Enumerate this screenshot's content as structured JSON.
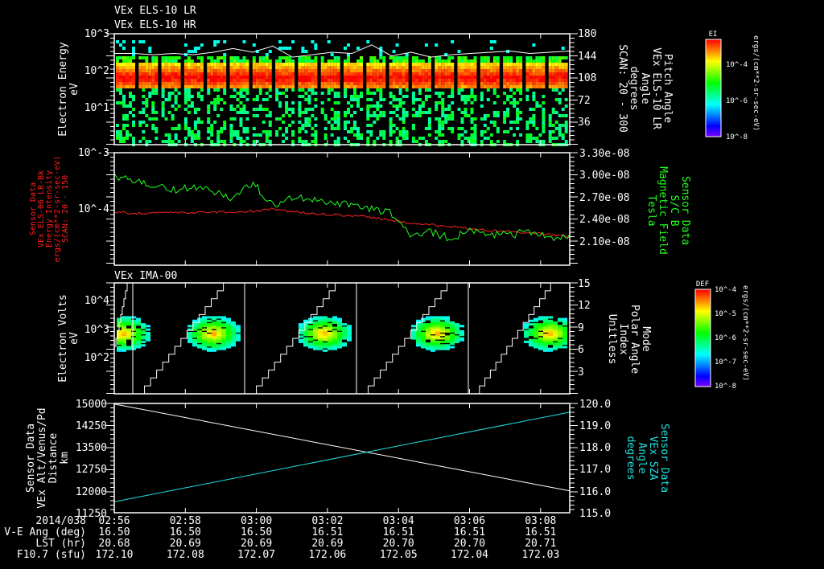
{
  "titles": {
    "p1a": "VEx ELS-10 LR",
    "p1b": "VEx ELS-10 HR",
    "p3": "VEx IMA-00"
  },
  "colors": {
    "green": "#20ff20",
    "red": "#ff2020",
    "cyan": "#20e0e0",
    "white": "#ffffff"
  },
  "chart_data": [
    {
      "type": "heatmap",
      "title": "VEx ELS-10 LR / VEx ELS-10 HR",
      "ylabel": [
        "Electron Energy",
        "eV"
      ],
      "yticks": [
        "10^3",
        "10^2",
        "10^1"
      ],
      "ylim_log10": [
        0,
        3
      ],
      "y2label": [
        "Pitch Angle",
        "VEx ELS-10 LR",
        "Angle",
        "degrees",
        "SCAN: 20 - 300"
      ],
      "y2ticks": [
        "180",
        "144",
        "108",
        "72",
        "36"
      ],
      "y2lim": [
        0,
        180
      ],
      "colorbar": {
        "label": "EI",
        "ticks": [
          "10^-4",
          "10^-6",
          "10^-8"
        ],
        "units": "ergs/(cm**2-sr-sec-eV)"
      },
      "peak_energy_eV": 60,
      "scan_blocks": 20,
      "pitch_angle_line_deg": [
        148,
        148,
        146,
        148,
        146,
        150,
        156,
        150,
        160,
        142,
        146,
        150,
        148,
        162,
        144,
        150,
        142,
        146,
        148,
        150,
        152,
        148,
        150,
        152
      ]
    },
    {
      "type": "line",
      "ylabel": [
        "Sensor Data",
        "VEx ELS-06 LR-Bk",
        "Energy Intensity",
        "ergs/(cm**2-sr-sec-eV)",
        "SCAN: 20 - 150"
      ],
      "yticks": [
        "10^-3",
        "10^-4"
      ],
      "ylim_log10": [
        -5,
        -3
      ],
      "y2label": [
        "Sensor Data",
        "S/C B",
        "Magnetic Field",
        "Tesla"
      ],
      "y2ticks": [
        "3.30e-08",
        "3.00e-08",
        "2.70e-08",
        "2.40e-08",
        "2.10e-08"
      ],
      "y2lim": [
        1.8e-08,
        3.3e-08
      ],
      "series": [
        {
          "name": "ELS-06 LR-Bk energy intensity",
          "color": "red",
          "axis": "left",
          "values_log10": [
            -4.05,
            -4.08,
            -4.07,
            -4.06,
            -4.07,
            -4.05,
            -4.06,
            -4.04,
            -4.0,
            -4.05,
            -4.08,
            -4.1,
            -4.12,
            -4.15,
            -4.2,
            -4.25,
            -4.28,
            -4.32,
            -4.35,
            -4.38,
            -4.4,
            -4.42,
            -4.45,
            -4.5
          ]
        },
        {
          "name": "S/C B magnetic field",
          "color": "green",
          "axis": "right",
          "values": [
            3e-08,
            2.92e-08,
            2.88e-08,
            2.8e-08,
            2.85e-08,
            2.78e-08,
            2.7e-08,
            2.9e-08,
            2.6e-08,
            2.7e-08,
            2.68e-08,
            2.65e-08,
            2.6e-08,
            2.55e-08,
            2.5e-08,
            2.2e-08,
            2.25e-08,
            2.15e-08,
            2.28e-08,
            2.22e-08,
            2.2e-08,
            2.25e-08,
            2.15e-08,
            2.2e-08
          ]
        }
      ]
    },
    {
      "type": "heatmap",
      "title": "VEx IMA-00",
      "ylabel": [
        "Electron Volts",
        "eV"
      ],
      "yticks": [
        "10^4",
        "10^3",
        "10^2"
      ],
      "ylim_log10": [
        0.8,
        4.6
      ],
      "y2label": [
        "Mode",
        "Polar Angle",
        "Index",
        "Unitless"
      ],
      "y2ticks": [
        "15",
        "12",
        "9",
        "6",
        "3"
      ],
      "y2lim": [
        0,
        15
      ],
      "colorbar": {
        "label": "DEF",
        "ticks": [
          "10^-4",
          "10^-5",
          "10^-6",
          "10^-7",
          "10^-8"
        ],
        "units": "ergs/(cm**2-sr-sec-eV)"
      },
      "blob_centers_time": [
        "02:56:15",
        "02:58:45",
        "03:01:50",
        "03:05:00",
        "03:08:10"
      ],
      "scan_resets_time": [
        "02:56:30",
        "02:59:40",
        "03:02:50",
        "03:05:58"
      ]
    },
    {
      "type": "line",
      "ylabel": [
        "Sensor Data",
        "VEx Alt/Venus/Pd",
        "Distance",
        "km"
      ],
      "yticks": [
        "15000",
        "14250",
        "13500",
        "12750",
        "12000",
        "11250"
      ],
      "ylim": [
        11250,
        15000
      ],
      "y2label": [
        "Sensor Data",
        "VEx SZA",
        "Angle",
        "degrees"
      ],
      "y2ticks": [
        "120.0",
        "119.0",
        "118.0",
        "117.0",
        "116.0",
        "115.0"
      ],
      "y2lim": [
        115,
        120
      ],
      "series": [
        {
          "name": "Altitude",
          "color": "white",
          "axis": "left",
          "x": [
            "02:56",
            "03:08:48"
          ],
          "values": [
            14980,
            12000
          ]
        },
        {
          "name": "SZA",
          "color": "cyan",
          "axis": "right",
          "x": [
            "02:56",
            "03:08:48"
          ],
          "values": [
            115.5,
            119.6
          ]
        }
      ]
    }
  ],
  "time_axis": {
    "row_labels": [
      "2014/038",
      "V-E Ang (deg)",
      "LST (hr)",
      "F10.7 (sfu)"
    ],
    "ticks": [
      "02:56",
      "02:58",
      "03:00",
      "03:02",
      "03:04",
      "03:06",
      "03:08"
    ],
    "ve_ang": [
      "16.50",
      "16.50",
      "16.50",
      "16.51",
      "16.51",
      "16.51",
      "16.51"
    ],
    "lst": [
      "20.68",
      "20.69",
      "20.69",
      "20.69",
      "20.70",
      "20.70",
      "20.71"
    ],
    "f107": [
      "172.10",
      "172.08",
      "172.07",
      "172.06",
      "172.05",
      "172.04",
      "172.03"
    ]
  }
}
